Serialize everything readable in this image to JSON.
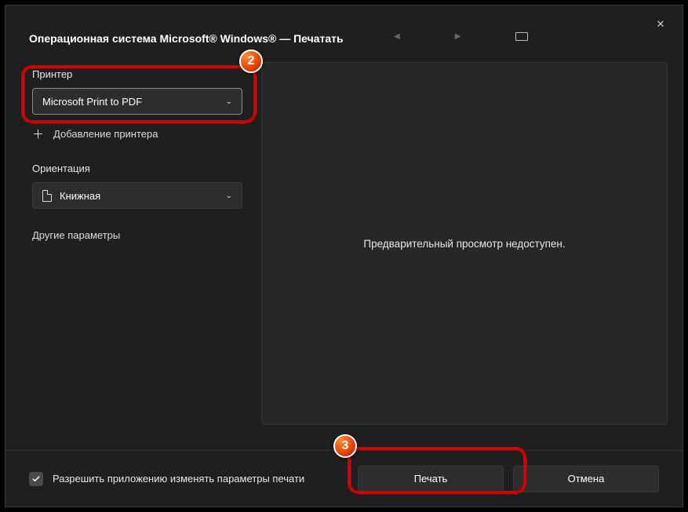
{
  "title": "Операционная система Microsoft® Windows® — Печатать",
  "printer": {
    "label": "Принтер",
    "value": "Microsoft Print to PDF",
    "add": "Добавление принтера"
  },
  "orientation": {
    "label": "Ориентация",
    "value": "Книжная"
  },
  "more": "Другие параметры",
  "preview_msg": "Предварительный просмотр недоступен.",
  "allow_change": "Разрешить приложению изменять параметры печати",
  "print_btn": "Печать",
  "cancel_btn": "Отмена",
  "badges": {
    "b2": "2",
    "b3": "3"
  }
}
